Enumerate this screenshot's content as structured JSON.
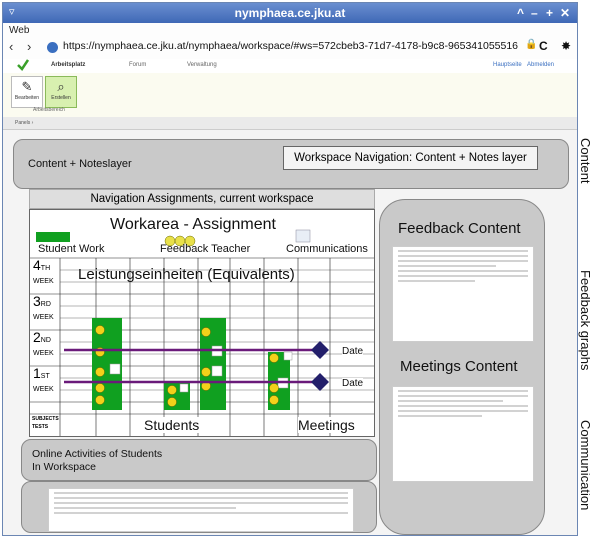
{
  "browser": {
    "window_title": "nymphaea.ce.jku.at",
    "menu_label": "Web",
    "url": "https://nymphaea.ce.jku.at/nymphaea/workspace/#ws=572cbeb3-71d7-4178-b9c8-965341055516",
    "back_glyph": "‹",
    "forward_glyph": "›",
    "lock_glyph": "🔒",
    "reload_glyph": "C",
    "settings_glyph": "✸",
    "window_controls": [
      "^",
      "–",
      "+",
      "✕"
    ],
    "menu_glyph": "▿"
  },
  "app": {
    "tabs": [
      "Arbeitsplatz",
      "Forum",
      "Verwaltung"
    ],
    "right_links": [
      "Hauptseite",
      "Abmelden"
    ],
    "ribbon_buttons": [
      "Bearbeiten",
      "Erstellen"
    ],
    "ribbon_group": "Arbeitsbereich",
    "panel_label": "Panels ›"
  },
  "layers": {
    "content_notes": "Content + Noteslayer",
    "workspace_nav": "Workspace Navigation: Content + Notes layer",
    "navigation_assignments": "Navigation Assignments, current workspace",
    "online_activities_line1": "Online Activities of Students",
    "online_activities_line2": "In Workspace",
    "feedback_content": "Feedback Content",
    "meetings_content": "Meetings Content"
  },
  "workarea": {
    "title": "Workarea -  Assignment",
    "student_work": "Student Work",
    "feedback_teacher": "Feedback Teacher",
    "communications": "Communications",
    "heading": "Leistungseinheiten (Equivalents)",
    "weeks": [
      {
        "num": "4",
        "suffix": "TH",
        "label": "WEEK"
      },
      {
        "num": "3",
        "suffix": "RD",
        "label": "WEEK"
      },
      {
        "num": "2",
        "suffix": "ND",
        "label": "WEEK"
      },
      {
        "num": "1",
        "suffix": "ST",
        "label": "WEEK"
      }
    ],
    "subjects_line1": "SUBJECTS",
    "subjects_line2": "TESTS",
    "students": "Students",
    "meetings": "Meetings",
    "date_labels": [
      "Date",
      "Date"
    ],
    "colors": {
      "green": "#10a020",
      "purple": "#6a1a7a",
      "navy": "#231f6b",
      "smiley": "#f2d11a"
    }
  },
  "side_labels": {
    "content": "Content",
    "feedback": "Feedback graphs",
    "communication": "Communication"
  }
}
